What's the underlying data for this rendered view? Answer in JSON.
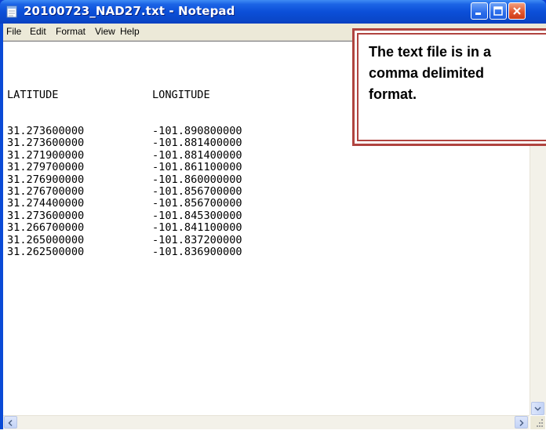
{
  "window": {
    "title": "20100723_NAD27.txt - Notepad",
    "colors": {
      "titlebar": "#0a4ad6",
      "close_button": "#e2572e",
      "menubar": "#ece9d8",
      "callout_border": "#b04440"
    }
  },
  "menu": {
    "items": [
      {
        "label": "File"
      },
      {
        "label": "Edit"
      },
      {
        "label": "Format"
      },
      {
        "label": "View"
      },
      {
        "label": "Help"
      }
    ]
  },
  "document": {
    "headers": [
      "LATITUDE",
      "LONGITUDE"
    ],
    "rows": [
      [
        "31.273600000",
        "-101.890800000"
      ],
      [
        "31.273600000",
        "-101.881400000"
      ],
      [
        "31.271900000",
        "-101.881400000"
      ],
      [
        "31.279700000",
        "-101.861100000"
      ],
      [
        "31.276900000",
        "-101.860000000"
      ],
      [
        "31.276700000",
        "-101.856700000"
      ],
      [
        "31.274400000",
        "-101.856700000"
      ],
      [
        "31.273600000",
        "-101.845300000"
      ],
      [
        "31.266700000",
        "-101.841100000"
      ],
      [
        "31.265000000",
        "-101.837200000"
      ],
      [
        "31.262500000",
        "-101.836900000"
      ]
    ]
  },
  "callout": {
    "text": "The text file is in a\ncomma delimited\nformat."
  },
  "icons": {
    "app": "notepad-icon",
    "minimize": "minimize-icon",
    "maximize": "maximize-icon",
    "close": "close-icon"
  }
}
